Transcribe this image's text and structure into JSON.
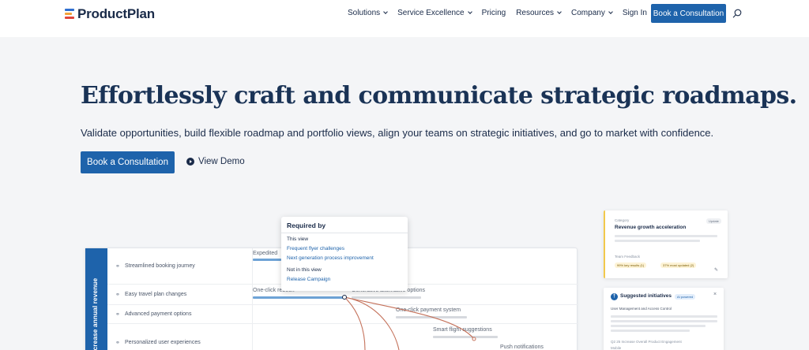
{
  "header": {
    "logo_text": "ProductPlan",
    "nav": [
      {
        "label": "Solutions",
        "dropdown": true
      },
      {
        "label": "Service Excellence",
        "dropdown": true
      },
      {
        "label": "Pricing",
        "dropdown": false
      },
      {
        "label": "Resources",
        "dropdown": true
      },
      {
        "label": "Company",
        "dropdown": true
      },
      {
        "label": "Sign In",
        "dropdown": false
      }
    ],
    "cta_label": "Book a Consultation",
    "search_icon": "search-icon"
  },
  "hero": {
    "title": "Effortlessly craft and communicate strategic roadmaps.",
    "subtitle": "Validate opportunities, build flexible roadmap and portfolio views, align your teams on strategic initiatives, and go to market with confidence.",
    "cta_label": "Book a Consultation",
    "demo_label": "View Demo"
  },
  "roadmap": {
    "lane_label": "Increase annual revenue",
    "rows": [
      {
        "label": "Streamlined booking journey"
      },
      {
        "label": "Easy travel plan changes"
      },
      {
        "label": "Advanced payment options"
      },
      {
        "label": "Personalized user experiences"
      }
    ],
    "bars": [
      {
        "label": "Expedited",
        "style": "blue"
      },
      {
        "label": "One-click rebook",
        "style": "blue"
      },
      {
        "label": "Generative alternative options",
        "style": "grey"
      },
      {
        "label": "One-click payment system",
        "style": "grey"
      },
      {
        "label": "Smart flight suggestions",
        "style": "grey"
      },
      {
        "label": "Push notifications",
        "style": "grey"
      }
    ]
  },
  "popover": {
    "title": "Required by",
    "this_view_heading": "This view",
    "this_view_links": [
      "Frequent flyer challenges",
      "Next generation process improvement"
    ],
    "not_in_view_heading": "Not in this view",
    "not_in_view_links": [
      "Release Campaign"
    ]
  },
  "card_category": {
    "kicker": "Category",
    "badge": "Update",
    "title": "Revenue growth acceleration",
    "section": "Team Feedback",
    "stats": [
      "99% key results (1)",
      "37% most updated (2)"
    ]
  },
  "card_initiatives": {
    "title": "Suggested initiatives",
    "badge": "AI powered",
    "subtitle": "User Management and Access Control",
    "footer": "Q2 25 Increase Overall Product Engagement",
    "footer2": "Mobile"
  },
  "colors": {
    "brand_blue": "#1e63ab",
    "navy_text": "#1a2b49",
    "connector": "#c4715a",
    "logo_bars": [
      "#2f6fd0",
      "#f2a33a",
      "#e0453a"
    ]
  }
}
